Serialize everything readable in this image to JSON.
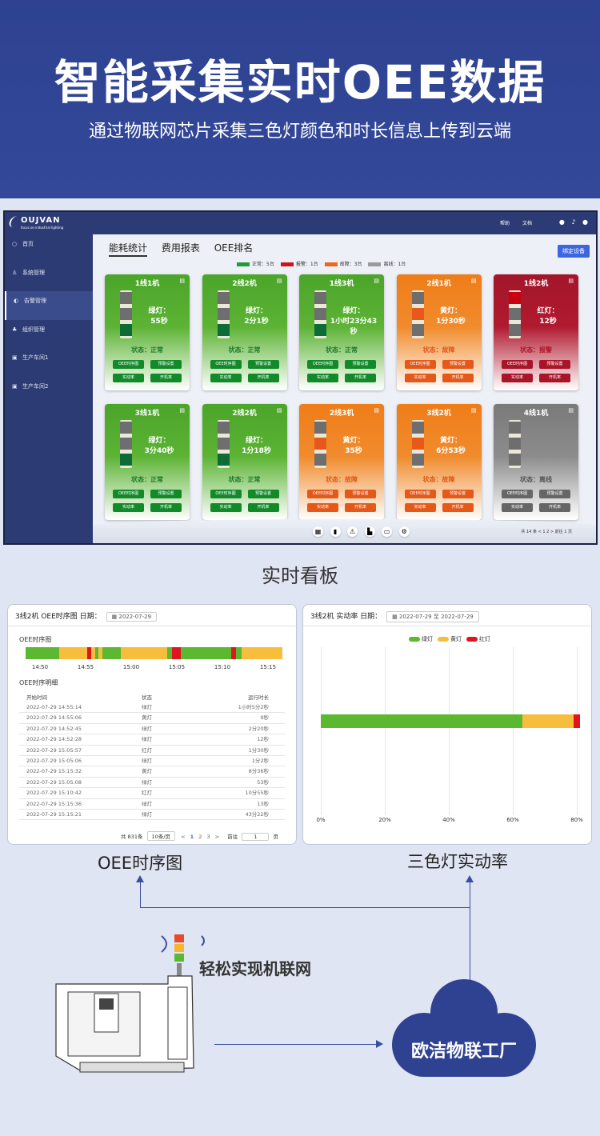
{
  "hero": {
    "title": "智能采集实时OEE数据",
    "subtitle": "通过物联网芯片采集三色灯颜色和时长信息上传到云端"
  },
  "app": {
    "brand": "OUJVAN",
    "brand_sub": "focus on industrial lighting",
    "top_links": [
      "帮助",
      "文档"
    ],
    "sidebar": [
      {
        "label": "首页",
        "icon": "home-icon"
      },
      {
        "label": "系统管理",
        "icon": "user-icon"
      },
      {
        "label": "告警管理",
        "icon": "alarm-icon"
      },
      {
        "label": "组织管理",
        "icon": "org-icon"
      },
      {
        "label": "生产车间1",
        "icon": "grid-icon"
      },
      {
        "label": "生产车间2",
        "icon": "grid-icon"
      }
    ],
    "tabs": [
      "能耗统计",
      "费用报表",
      "OEE排名"
    ],
    "bind_button": "绑定设备",
    "legend": [
      {
        "label": "正常：5台",
        "color": "#1f9a3a"
      },
      {
        "label": "报警：1台",
        "color": "#d0141e"
      },
      {
        "label": "故障：3台",
        "color": "#ea6a1c"
      },
      {
        "label": "离线：1台",
        "color": "#9a9a9a"
      }
    ],
    "card_buttons": [
      "OEE时序图",
      "预警设置",
      "实动率",
      "开机率"
    ],
    "cards": [
      {
        "name": "1线1机",
        "light": "绿灯：",
        "time": "55秒",
        "state": "状态：正常",
        "kind": "g",
        "lit": 3
      },
      {
        "name": "2线2机",
        "light": "绿灯：",
        "time": "2分1秒",
        "state": "状态：正常",
        "kind": "g",
        "lit": 3
      },
      {
        "name": "1线3机",
        "light": "绿灯：",
        "time": "1小时23分43秒",
        "state": "状态：正常",
        "kind": "g",
        "lit": 3
      },
      {
        "name": "2线1机",
        "light": "黄灯：",
        "time": "1分30秒",
        "state": "状态：故障",
        "kind": "y",
        "lit": 2
      },
      {
        "name": "1线2机",
        "light": "红灯：",
        "time": "12秒",
        "state": "状态：报警",
        "kind": "r",
        "lit": 1
      },
      {
        "name": "3线1机",
        "light": "绿灯：",
        "time": "3分40秒",
        "state": "状态：正常",
        "kind": "g",
        "lit": 3
      },
      {
        "name": "2线2机",
        "light": "绿灯：",
        "time": "1分18秒",
        "state": "状态：正常",
        "kind": "g",
        "lit": 3
      },
      {
        "name": "2线3机",
        "light": "黄灯：",
        "time": "35秒",
        "state": "状态：故障",
        "kind": "y",
        "lit": 2
      },
      {
        "name": "3线2机",
        "light": "黄灯：",
        "time": "6分53秒",
        "state": "状态：故障",
        "kind": "y",
        "lit": 2
      },
      {
        "name": "4线1机",
        "light": "",
        "time": "",
        "state": "状态：离线",
        "kind": "o",
        "lit": 0
      }
    ],
    "pager": "共 14 条   <   1   2   >    前往   1   页"
  },
  "section_title": "实时看板",
  "oee_panel": {
    "header": "3线2机  OEE时序图    日期：",
    "date": "2022-07-29",
    "chart_title": "OEE时序图",
    "x_ticks": [
      "14:50",
      "14:55",
      "15:00",
      "15:05",
      "15:10",
      "15:15"
    ],
    "detail_title": "OEE时序明细",
    "columns": [
      "开始时间",
      "状态",
      "运行时长"
    ],
    "rows": [
      [
        "2022-07-29  14:55:14",
        "绿灯",
        "1小时5分2秒"
      ],
      [
        "2022-07-29  14:55:06",
        "黄灯",
        "9秒"
      ],
      [
        "2022-07-29  14:52:45",
        "绿灯",
        "2分20秒"
      ],
      [
        "2022-07-29  14:52:28",
        "绿灯",
        "12秒"
      ],
      [
        "2022-07-29  15:05:57",
        "红灯",
        "1分30秒"
      ],
      [
        "2022-07-29  15:05:06",
        "绿灯",
        "1分2秒"
      ],
      [
        "2022-07-29  15:15:32",
        "黄灯",
        "8分36秒"
      ],
      [
        "2022-07-29  15:05:08",
        "绿灯",
        "53秒"
      ],
      [
        "2022-07-29  15:10:42",
        "红灯",
        "10分55秒"
      ],
      [
        "2022-07-29  15:15:36",
        "绿灯",
        "13秒"
      ],
      [
        "2022-07-29  15:15:21",
        "绿灯",
        "43分22秒"
      ]
    ],
    "total": "共 831条",
    "page_size": "10条/页",
    "pages": [
      "<",
      "1",
      "2",
      "3",
      ">"
    ],
    "goto": "前往",
    "goto_value": "1",
    "page_unit": "页"
  },
  "rate_panel": {
    "header": "3线2机  实动率    日期：",
    "date_from": "2022-07-29",
    "date_sep": "至",
    "date_to": "2022-07-29"
  },
  "chart_data": [
    {
      "type": "timeline",
      "title": "OEE时序图",
      "x_ticks": [
        "14:50",
        "14:55",
        "15:00",
        "15:05",
        "15:10",
        "15:15"
      ],
      "segments": [
        {
          "state": "green",
          "start": 0.0,
          "end": 0.13
        },
        {
          "state": "yellow",
          "start": 0.13,
          "end": 0.24
        },
        {
          "state": "red",
          "start": 0.24,
          "end": 0.255
        },
        {
          "state": "yellow",
          "start": 0.255,
          "end": 0.27
        },
        {
          "state": "green",
          "start": 0.27,
          "end": 0.285
        },
        {
          "state": "yellow",
          "start": 0.285,
          "end": 0.3
        },
        {
          "state": "green",
          "start": 0.3,
          "end": 0.37
        },
        {
          "state": "yellow",
          "start": 0.37,
          "end": 0.55
        },
        {
          "state": "green",
          "start": 0.55,
          "end": 0.57
        },
        {
          "state": "red",
          "start": 0.57,
          "end": 0.605
        },
        {
          "state": "green",
          "start": 0.605,
          "end": 0.8
        },
        {
          "state": "red",
          "start": 0.8,
          "end": 0.82
        },
        {
          "state": "green",
          "start": 0.82,
          "end": 0.84
        },
        {
          "state": "yellow",
          "start": 0.84,
          "end": 1.0
        }
      ],
      "colors": {
        "green": "#5bb830",
        "yellow": "#f7be3e",
        "red": "#e0141e"
      }
    },
    {
      "type": "bar",
      "title": "实动率",
      "orientation": "horizontal",
      "stacked": true,
      "series": [
        {
          "name": "绿灯",
          "values": [
            63
          ],
          "color": "#5bb830"
        },
        {
          "name": "黄灯",
          "values": [
            16
          ],
          "color": "#f7be3e"
        },
        {
          "name": "红灯",
          "values": [
            2
          ],
          "color": "#e0141e"
        }
      ],
      "x_ticks": [
        "0%",
        "20%",
        "40%",
        "60%",
        "80%"
      ],
      "xlim": [
        0,
        80
      ]
    }
  ],
  "captions": {
    "oee": "OEE时序图",
    "rate": "三色灯实动率",
    "iot": "轻松实现机联网",
    "cloud": "欧洁物联工厂"
  }
}
